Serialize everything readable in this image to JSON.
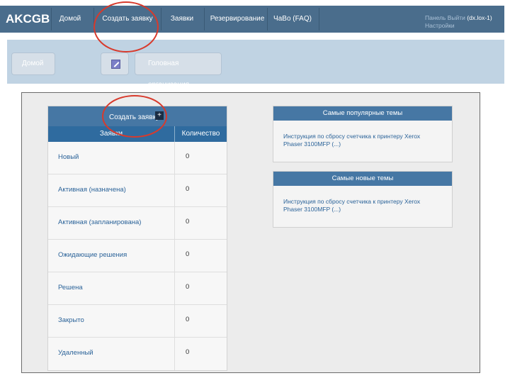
{
  "navbar": {
    "brand": "AKCGB",
    "items": [
      {
        "label": "Домой"
      },
      {
        "label": "Создать заявку"
      },
      {
        "label": "Заявки"
      },
      {
        "label": "Резервирование"
      },
      {
        "label": "ЧаВо (FAQ)"
      }
    ],
    "user_panel": "Панель",
    "logout": "Выйти",
    "username": "(dx.lox-1)",
    "settings": "Настройки"
  },
  "subbar": {
    "home": "Домой",
    "organization": "Головная организация"
  },
  "tickets": {
    "create_label": "Создать заявку",
    "columns": [
      "Заявки",
      "Количество"
    ],
    "rows": [
      {
        "name": "Новый",
        "count": "0"
      },
      {
        "name": "Активная (назначена)",
        "count": "0"
      },
      {
        "name": "Активная (запланирована)",
        "count": "0"
      },
      {
        "name": "Ожидающие решения",
        "count": "0"
      },
      {
        "name": "Решена",
        "count": "0"
      },
      {
        "name": "Закрыто",
        "count": "0"
      },
      {
        "name": "Удаленный",
        "count": "0"
      }
    ]
  },
  "popular": {
    "title": "Самые популярные темы",
    "link": "Инструкция по сбросу счетчика к принтеру Xerox Phaser 3100MFP (...)"
  },
  "newest": {
    "title": "Самые новые темы",
    "link": "Инструкция по сбросу счетчика к принтеру Xerox Phaser 3100MFP (...)"
  },
  "colors": {
    "navbar": "#4a6d8c",
    "panel_header": "#4677a4",
    "table_header": "#2f6b9f",
    "link": "#2b6399",
    "annotation": "#d83a2c"
  }
}
